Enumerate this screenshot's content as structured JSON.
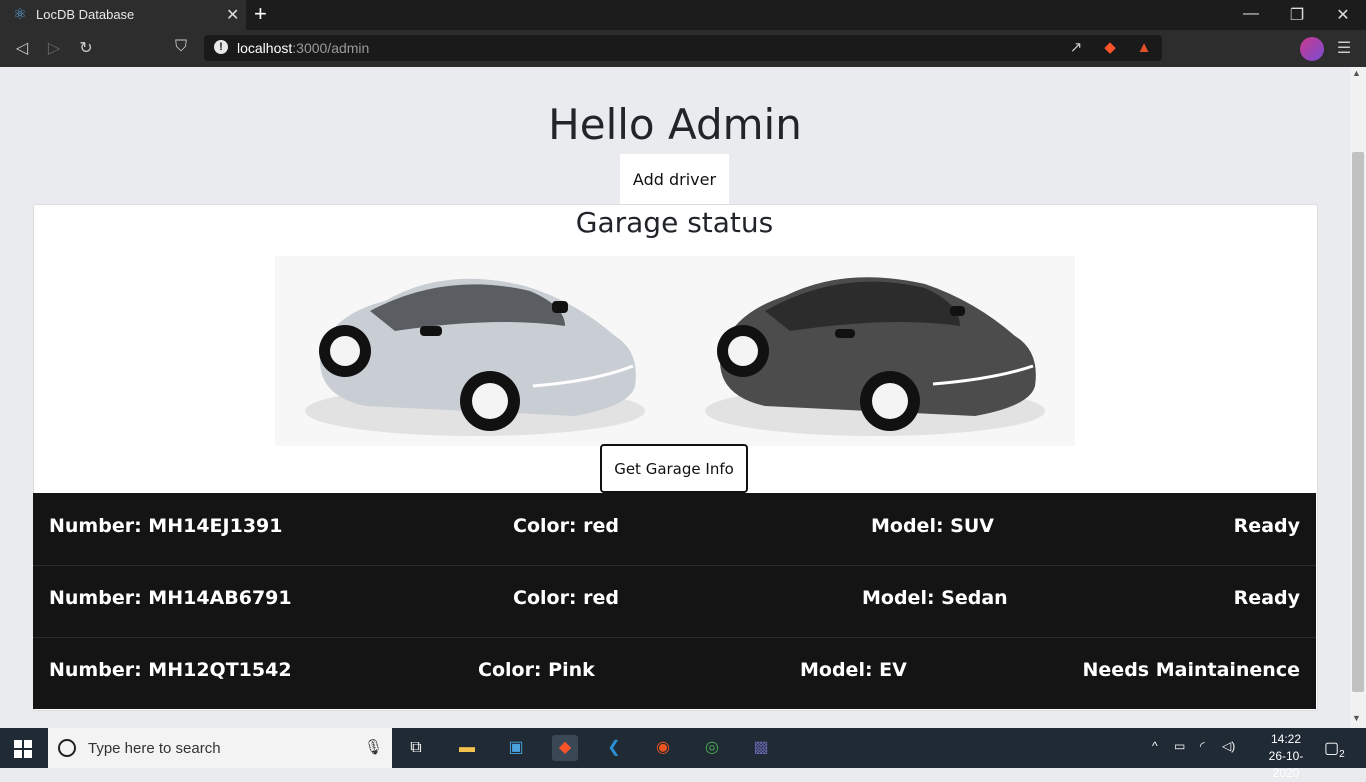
{
  "browser": {
    "tab_title": "LocDB Database",
    "tab_close": "✕",
    "new_tab": "+",
    "url_host": "localhost",
    "url_path": ":3000/admin",
    "info": "!",
    "controls": {
      "minimize": "—",
      "restore": "❐",
      "close": "✕"
    },
    "nav": {
      "back": "◁",
      "forward": "▷",
      "reload": "↻",
      "bookmark": "⛉"
    },
    "menu": "☰"
  },
  "page": {
    "greeting": "Hello Admin",
    "add_driver_label": "Add driver",
    "garage": {
      "title": "Garage status",
      "button_label": "Get Garage Info",
      "cars": [
        {
          "color": "#bfc4ca",
          "body": "#d7dbe0"
        },
        {
          "color": "#3a3a3a",
          "body": "#555555"
        }
      ],
      "rows": [
        {
          "number": "Number: MH14EJ1391",
          "color": "Color: red",
          "model": "Model: SUV",
          "status": "Ready"
        },
        {
          "number": "Number: MH14AB6791",
          "color": "Color: red",
          "model": "Model: Sedan",
          "status": "Ready"
        },
        {
          "number": "Number: MH12QT1542",
          "color": "Color: Pink",
          "model": "Model: EV",
          "status": "Needs Maintainence"
        }
      ]
    }
  },
  "taskbar": {
    "search_placeholder": "Type here to search",
    "time": "14:22",
    "date": "26-10-2020",
    "notifications": "2",
    "apps": [
      "task-view-icon",
      "file-explorer-icon",
      "store-icon",
      "brave-icon",
      "vscode-icon",
      "ubuntu-icon",
      "chrome-icon",
      "teams-icon"
    ]
  }
}
